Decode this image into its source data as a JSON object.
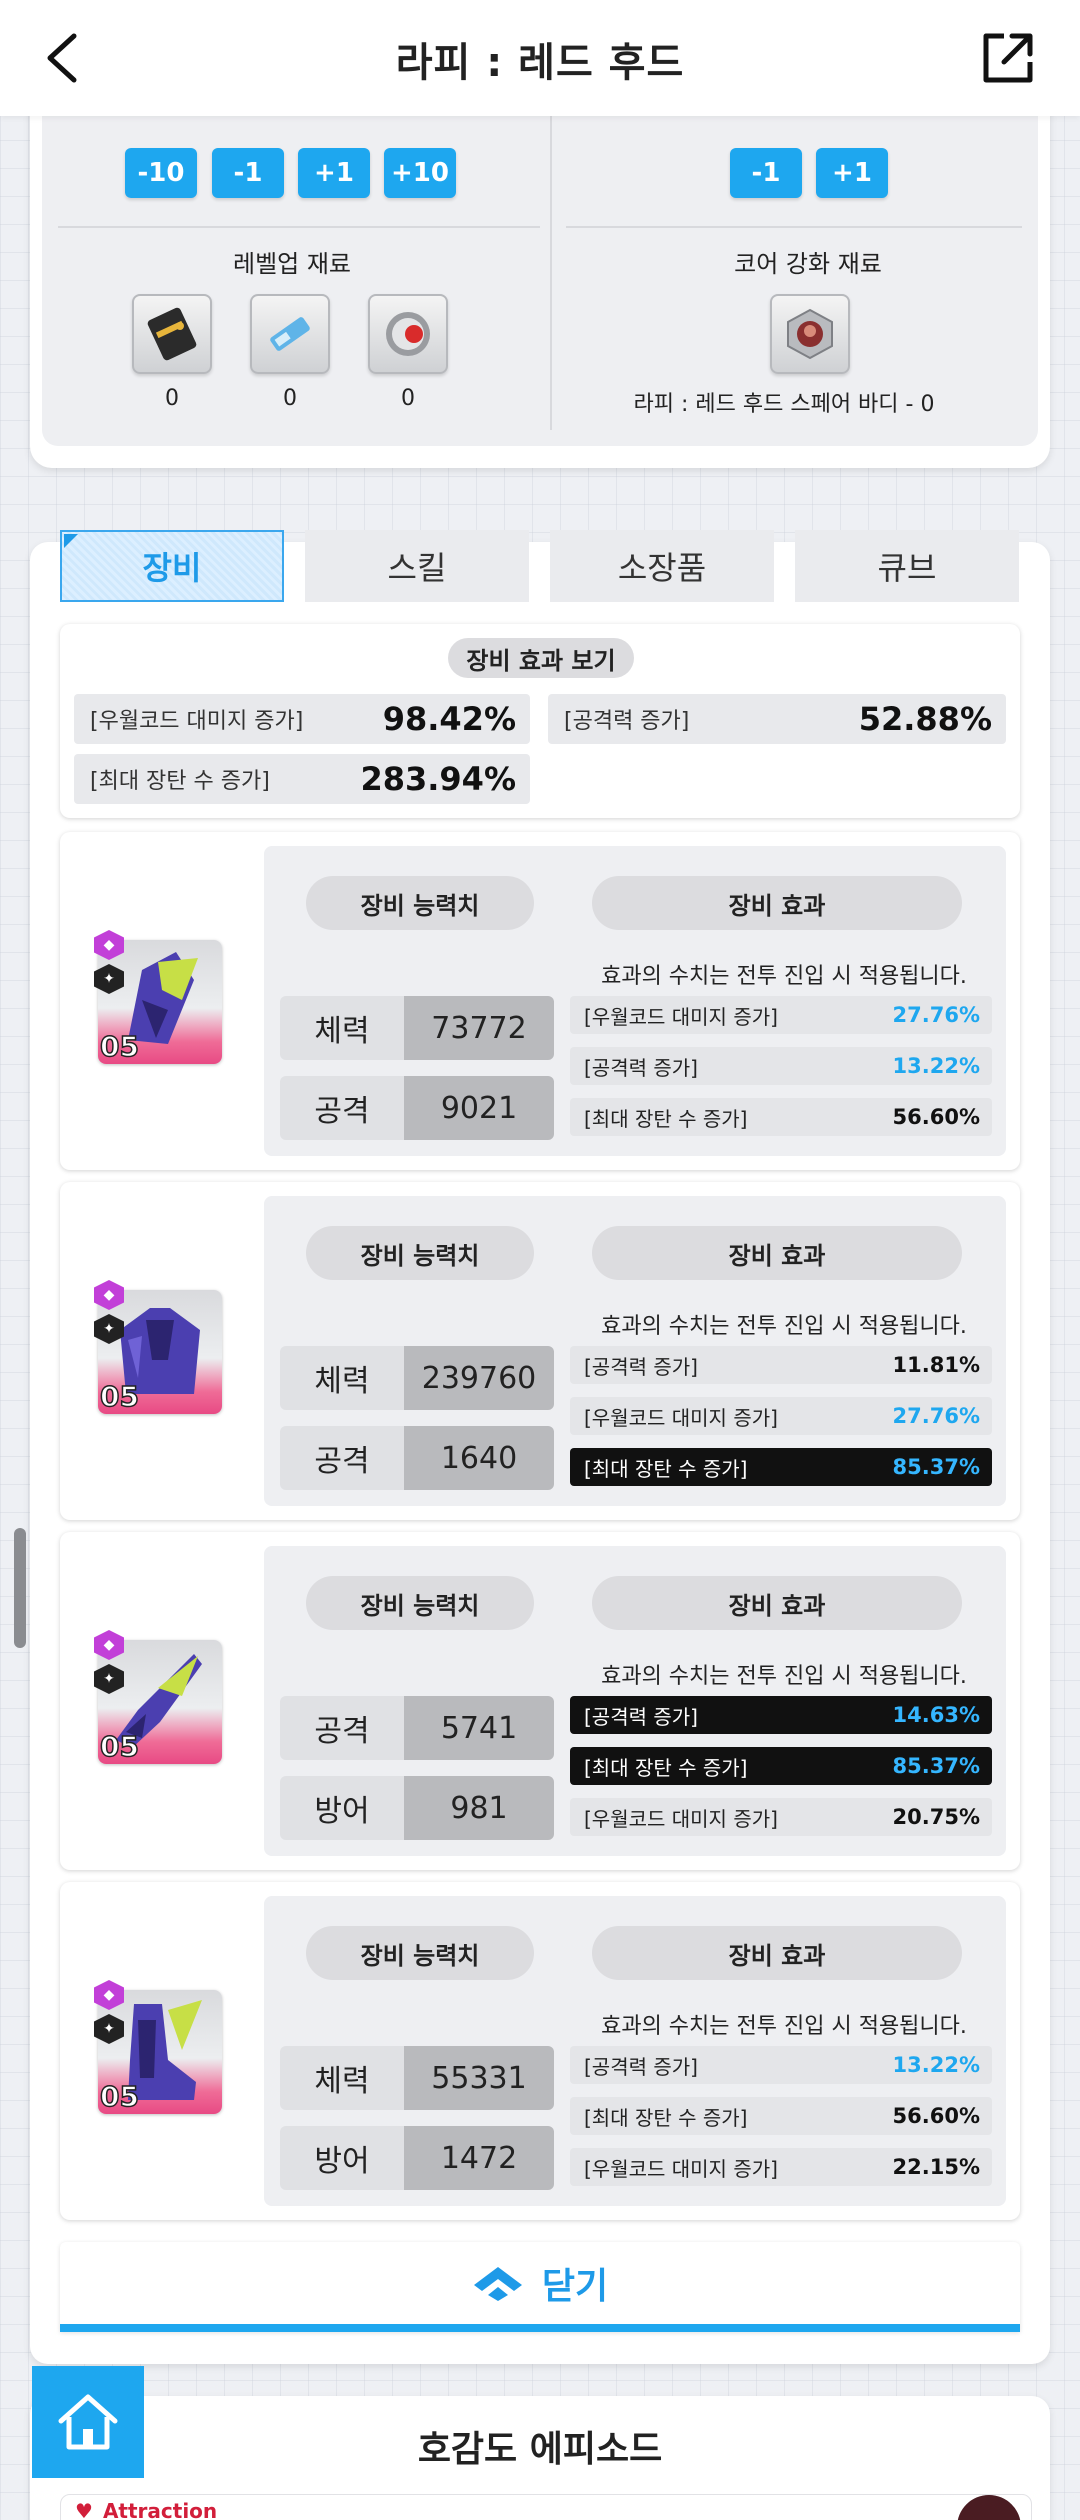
{
  "header": {
    "title": "라피 : 레드 후드"
  },
  "levelup": {
    "buttons": [
      "-10",
      "-1",
      "+1",
      "+10"
    ],
    "title": "레벨업 재료",
    "counts": [
      "0",
      "0",
      "0"
    ]
  },
  "core": {
    "buttons": [
      "-1",
      "+1"
    ],
    "title": "코어 강화 재료",
    "label": "라피 : 레드 후드 스페어 바디 - 0"
  },
  "tabs": [
    "장비",
    "스킬",
    "소장품",
    "큐브"
  ],
  "effects_summary": {
    "title": "장비 효과 보기",
    "items": [
      {
        "label": "[우월코드 대미지 증가]",
        "value": "98.42%"
      },
      {
        "label": "[공격력 증가]",
        "value": "52.88%"
      },
      {
        "label": "[최대 장탄 수 증가]",
        "value": "283.94%"
      }
    ]
  },
  "equip_labels": {
    "stats_title": "장비 능력치",
    "effects_title": "장비 효과",
    "notice": "효과의 수치는 전투 진입 시 적용됩니다."
  },
  "equipment": [
    {
      "level": "05",
      "stats": [
        {
          "k": "체력",
          "v": "73772"
        },
        {
          "k": "공격",
          "v": "9021"
        }
      ],
      "effects": [
        {
          "label": "[우월코드 대미지 증가]",
          "value": "27.76%",
          "value_color": "#1ea7ef",
          "dark": false
        },
        {
          "label": "[공격력 증가]",
          "value": "13.22%",
          "value_color": "#1ea7ef",
          "dark": false
        },
        {
          "label": "[최대 장탄 수 증가]",
          "value": "56.60%",
          "value_color": "#111111",
          "dark": false
        }
      ]
    },
    {
      "level": "05",
      "stats": [
        {
          "k": "체력",
          "v": "239760"
        },
        {
          "k": "공격",
          "v": "1640"
        }
      ],
      "effects": [
        {
          "label": "[공격력 증가]",
          "value": "11.81%",
          "value_color": "#111111",
          "dark": false
        },
        {
          "label": "[우월코드 대미지 증가]",
          "value": "27.76%",
          "value_color": "#1ea7ef",
          "dark": false
        },
        {
          "label": "[최대 장탄 수 증가]",
          "value": "85.37%",
          "value_color": "#35b6ff",
          "dark": true
        }
      ]
    },
    {
      "level": "05",
      "stats": [
        {
          "k": "공격",
          "v": "5741"
        },
        {
          "k": "방어",
          "v": "981"
        }
      ],
      "effects": [
        {
          "label": "[공격력 증가]",
          "value": "14.63%",
          "value_color": "#35b6ff",
          "dark": true
        },
        {
          "label": "[최대 장탄 수 증가]",
          "value": "85.37%",
          "value_color": "#35b6ff",
          "dark": true
        },
        {
          "label": "[우월코드 대미지 증가]",
          "value": "20.75%",
          "value_color": "#111111",
          "dark": false
        }
      ]
    },
    {
      "level": "05",
      "stats": [
        {
          "k": "체력",
          "v": "55331"
        },
        {
          "k": "방어",
          "v": "1472"
        }
      ],
      "effects": [
        {
          "label": "[공격력 증가]",
          "value": "13.22%",
          "value_color": "#1ea7ef",
          "dark": false
        },
        {
          "label": "[최대 장탄 수 증가]",
          "value": "56.60%",
          "value_color": "#111111",
          "dark": false
        },
        {
          "label": "[우월코드 대미지 증가]",
          "value": "22.15%",
          "value_color": "#111111",
          "dark": false
        }
      ]
    }
  ],
  "close": {
    "label": "닫기"
  },
  "bottom": {
    "title": "호감도 에피소드",
    "attraction": "_Attraction"
  },
  "colors": {
    "accent": "#1ea7ef",
    "highlight_value": "#35b6ff",
    "attraction_red": "#d21e3a"
  },
  "icons": {
    "back": "chevron-left-icon",
    "share": "external-link-icon",
    "close": "chevron-up-icon",
    "home": "home-icon",
    "heart": "heart-icon"
  }
}
